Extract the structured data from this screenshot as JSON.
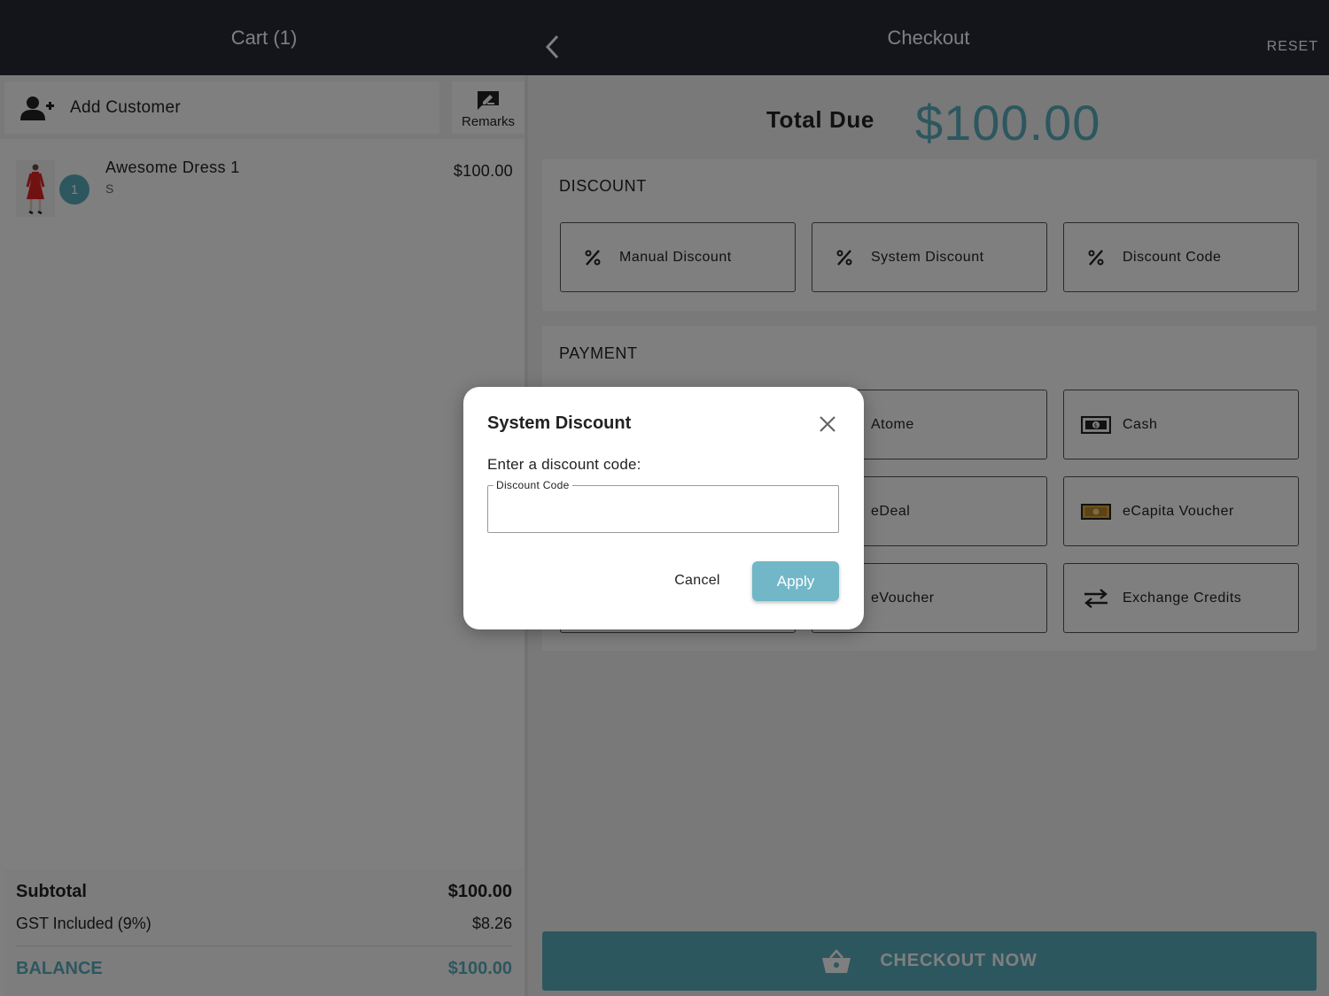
{
  "cart": {
    "title": "Cart (1)",
    "add_customer": "Add Customer",
    "remarks": "Remarks",
    "items": [
      {
        "name": "Awesome Dress 1",
        "variant": "S",
        "qty": "1",
        "price": "$100.00"
      }
    ],
    "subtotal_label": "Subtotal",
    "subtotal_value": "$100.00",
    "gst_label": "GST Included (9%)",
    "gst_value": "$8.26",
    "balance_label": "BALANCE",
    "balance_value": "$100.00"
  },
  "checkout": {
    "title": "Checkout",
    "reset": "RESET",
    "total_due_label": "Total Due",
    "total_due_value": "$100.00",
    "discount_title": "DISCOUNT",
    "discounts": [
      {
        "label": "Manual Discount",
        "icon": "percent-icon"
      },
      {
        "label": "System Discount",
        "icon": "percent-icon"
      },
      {
        "label": "Discount Code",
        "icon": "percent-icon"
      }
    ],
    "payment_title": "PAYMENT",
    "payments": [
      {
        "label": "Atome",
        "icon": "atome-icon"
      },
      {
        "label": "Cash",
        "icon": "cash-icon"
      },
      {
        "label": "eDeal",
        "icon": "deal-icon"
      },
      {
        "label": "eCapita Voucher",
        "icon": "voucher-icon"
      },
      {
        "label": "eVoucher",
        "icon": "voucher-icon"
      },
      {
        "label": "Exchange Credits",
        "icon": "exchange-icon"
      }
    ],
    "checkout_now": "CHECKOUT NOW"
  },
  "modal": {
    "title": "System Discount",
    "prompt": "Enter a discount code:",
    "field_label": "Discount Code",
    "field_value": "",
    "cancel": "Cancel",
    "apply": "Apply"
  },
  "colors": {
    "accent": "#5aaebf",
    "header": "#262a37",
    "apply_button": "#71b7c7"
  }
}
